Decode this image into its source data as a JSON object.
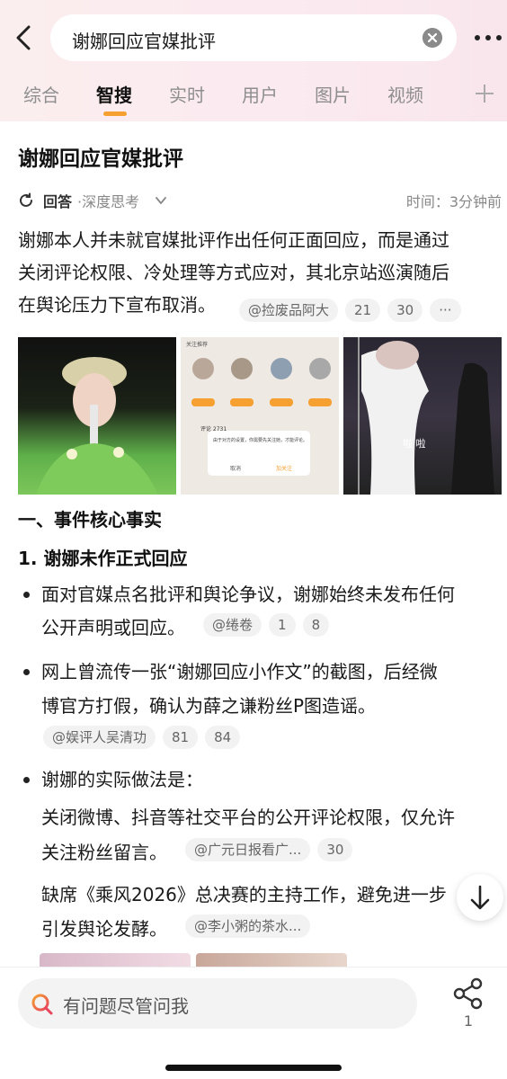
{
  "search": {
    "query": "谢娜回应官媒批评"
  },
  "tabs": [
    "综合",
    "智搜",
    "实时",
    "用户",
    "图片",
    "视频"
  ],
  "active_tab": "智搜",
  "answer": {
    "title": "谢娜回应官媒批评",
    "label": "回答",
    "sublabel": "·深度思考",
    "time": "时间：3分钟前",
    "summary_lines": [
      "谢娜本人并未就官媒批评作出任何正面回应，而是通过",
      "关闭评论权限、冷处理等方式应对，其北京站巡演随后",
      "在舆论压力下宣布取消。"
    ],
    "summary_chips": [
      "@捡废品阿大",
      "21",
      "30",
      "···"
    ],
    "image_texts": {
      "img2_header": "关注推荐",
      "img2_comment": "评论 2731",
      "img2_dialog": "由于对方的设置，你需要先关注她，才能评论。",
      "img2_cancel": "取消",
      "img2_follow": "加关注",
      "img3_caption": "啦 啦"
    },
    "section1": "一、事件核心事实",
    "sub1": "1. 谢娜未作正式回应",
    "bullets": [
      {
        "lines": [
          "面对官媒点名批评和舆论争议，谢娜始终未发布任何",
          "公开声明或回应。"
        ],
        "chips": [
          "@绻卷",
          "1",
          "8"
        ]
      },
      {
        "lines": [
          "网上曾流传一张“谢娜回应小作文”的截图，后经微",
          "博官方打假，确认为薛之谦粉丝P图造谣。"
        ],
        "chips": [
          "@娱评人吴清功",
          "81",
          "84"
        ]
      },
      {
        "lines": [
          "谢娜的实际做法是：",
          "关闭微博、抖音等社交平台的公开评论权限，仅允许",
          "关注粉丝留言。",
          "缺席《乘风2026》总决赛的主持工作，避免进一步",
          "引发舆论发酵。"
        ],
        "chips": [
          "@广元日报看广...",
          "30"
        ],
        "chips2": [
          "@李小粥的茶水..."
        ]
      }
    ]
  },
  "bottom_bar": {
    "ask_placeholder": "有问题尽管问我",
    "share_count": "1"
  },
  "colors": {
    "accent": "#f5a031",
    "header_bg": "#fbeeee",
    "chip_bg": "#f2f2f2"
  }
}
